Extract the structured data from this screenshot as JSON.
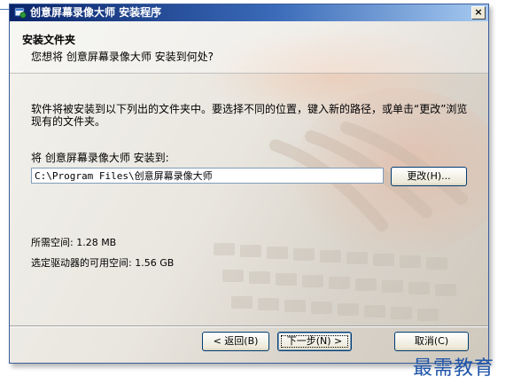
{
  "window": {
    "title": "创意屏幕录像大师  安装程序",
    "close_label": "×"
  },
  "header": {
    "title": "安装文件夹",
    "subtitle": "您想将 创意屏幕录像大师 安装到何处?"
  },
  "body": {
    "description": "软件将被安装到以下列出的文件夹中。要选择不同的位置，键入新的路径，或单击“更改”浏览现有的文件夹。",
    "install_label": "将 创意屏幕录像大师 安装到:",
    "install_path": "C:\\Program Files\\创意屏幕录像大师",
    "browse_label": "更改(H)...",
    "space_required": "所需空间: 1.28 MB",
    "space_available": "选定驱动器的可用空间: 1.56 GB"
  },
  "buttons": {
    "back": "< 返回(B)",
    "next": "下一步(N) >",
    "cancel": "取消(C)"
  },
  "watermark": "最需教育",
  "colors": {
    "titlebar_start": "#0a246a",
    "titlebar_end": "#a6caf0",
    "button_border": "#003c74",
    "watermark": "#1f55a8"
  }
}
